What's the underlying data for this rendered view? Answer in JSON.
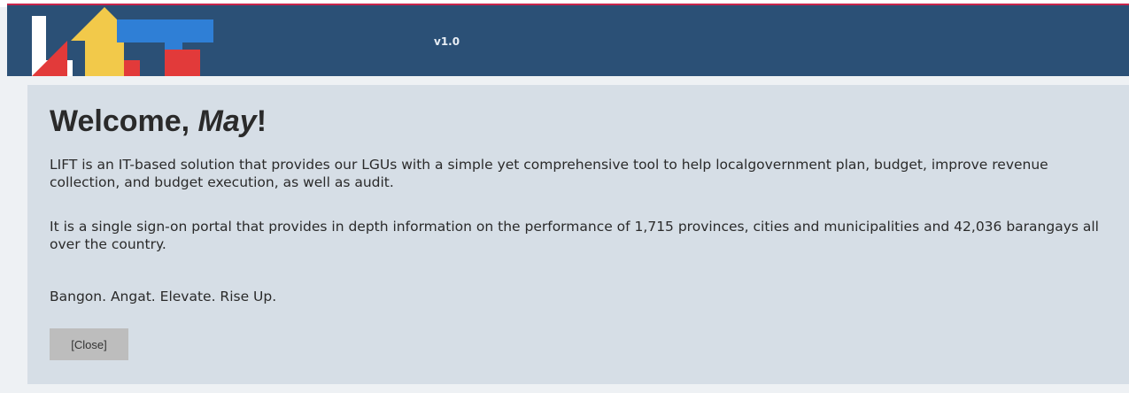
{
  "header": {
    "version": "v1.0",
    "logo_icon": "lift-logo-icon",
    "bar_color": "#2b5076",
    "accent_line_color": "#c8254b"
  },
  "welcome": {
    "greeting": "Welcome, ",
    "name": "May",
    "punct": "!"
  },
  "content": {
    "paragraph1": "LIFT is an IT-based solution that provides our LGUs with a simple yet comprehensive tool to help localgovernment plan, budget, improve revenue collection, and budget execution, as well as audit.",
    "paragraph2": "It is a single sign-on portal that provides in depth information on the performance of 1,715 provinces, cities and municipalities and 42,036 barangays all over the country.",
    "tagline": "Bangon. Angat. Elevate. Rise Up."
  },
  "actions": {
    "close_label": "[Close]"
  },
  "colors": {
    "panel_bg": "#d6dee6",
    "page_bg": "#eef1f4",
    "button_bg": "#bdbdbd"
  }
}
